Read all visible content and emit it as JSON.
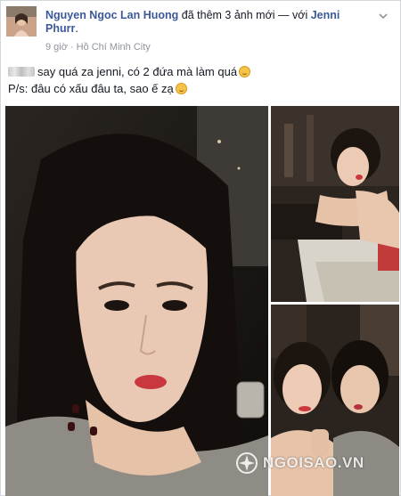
{
  "post": {
    "author": "Nguyen Ngoc Lan Huong",
    "action": " đã thêm 3 ảnh mới — với ",
    "tagged": "Jenni Phurr",
    "tagged_suffix": ".",
    "time": "9 giờ",
    "separator": " · ",
    "location": "Hồ Chí Minh City",
    "text_line1": "say quá za jenni, có 2 đứa mà làm quá",
    "text_line2": "P/s: đâu có xấu đâu ta, sao ế zạ",
    "menu_icon": "chevron-down-icon",
    "location_icon": "globe-icon"
  },
  "photos": [
    {
      "name": "selfie-main"
    },
    {
      "name": "jenni-couch"
    },
    {
      "name": "duo-selfie"
    }
  ],
  "watermark": {
    "text": "NGOISAO.VN"
  },
  "colors": {
    "link": "#3b5998",
    "meta": "#90949c",
    "border": "#d3d6db"
  }
}
